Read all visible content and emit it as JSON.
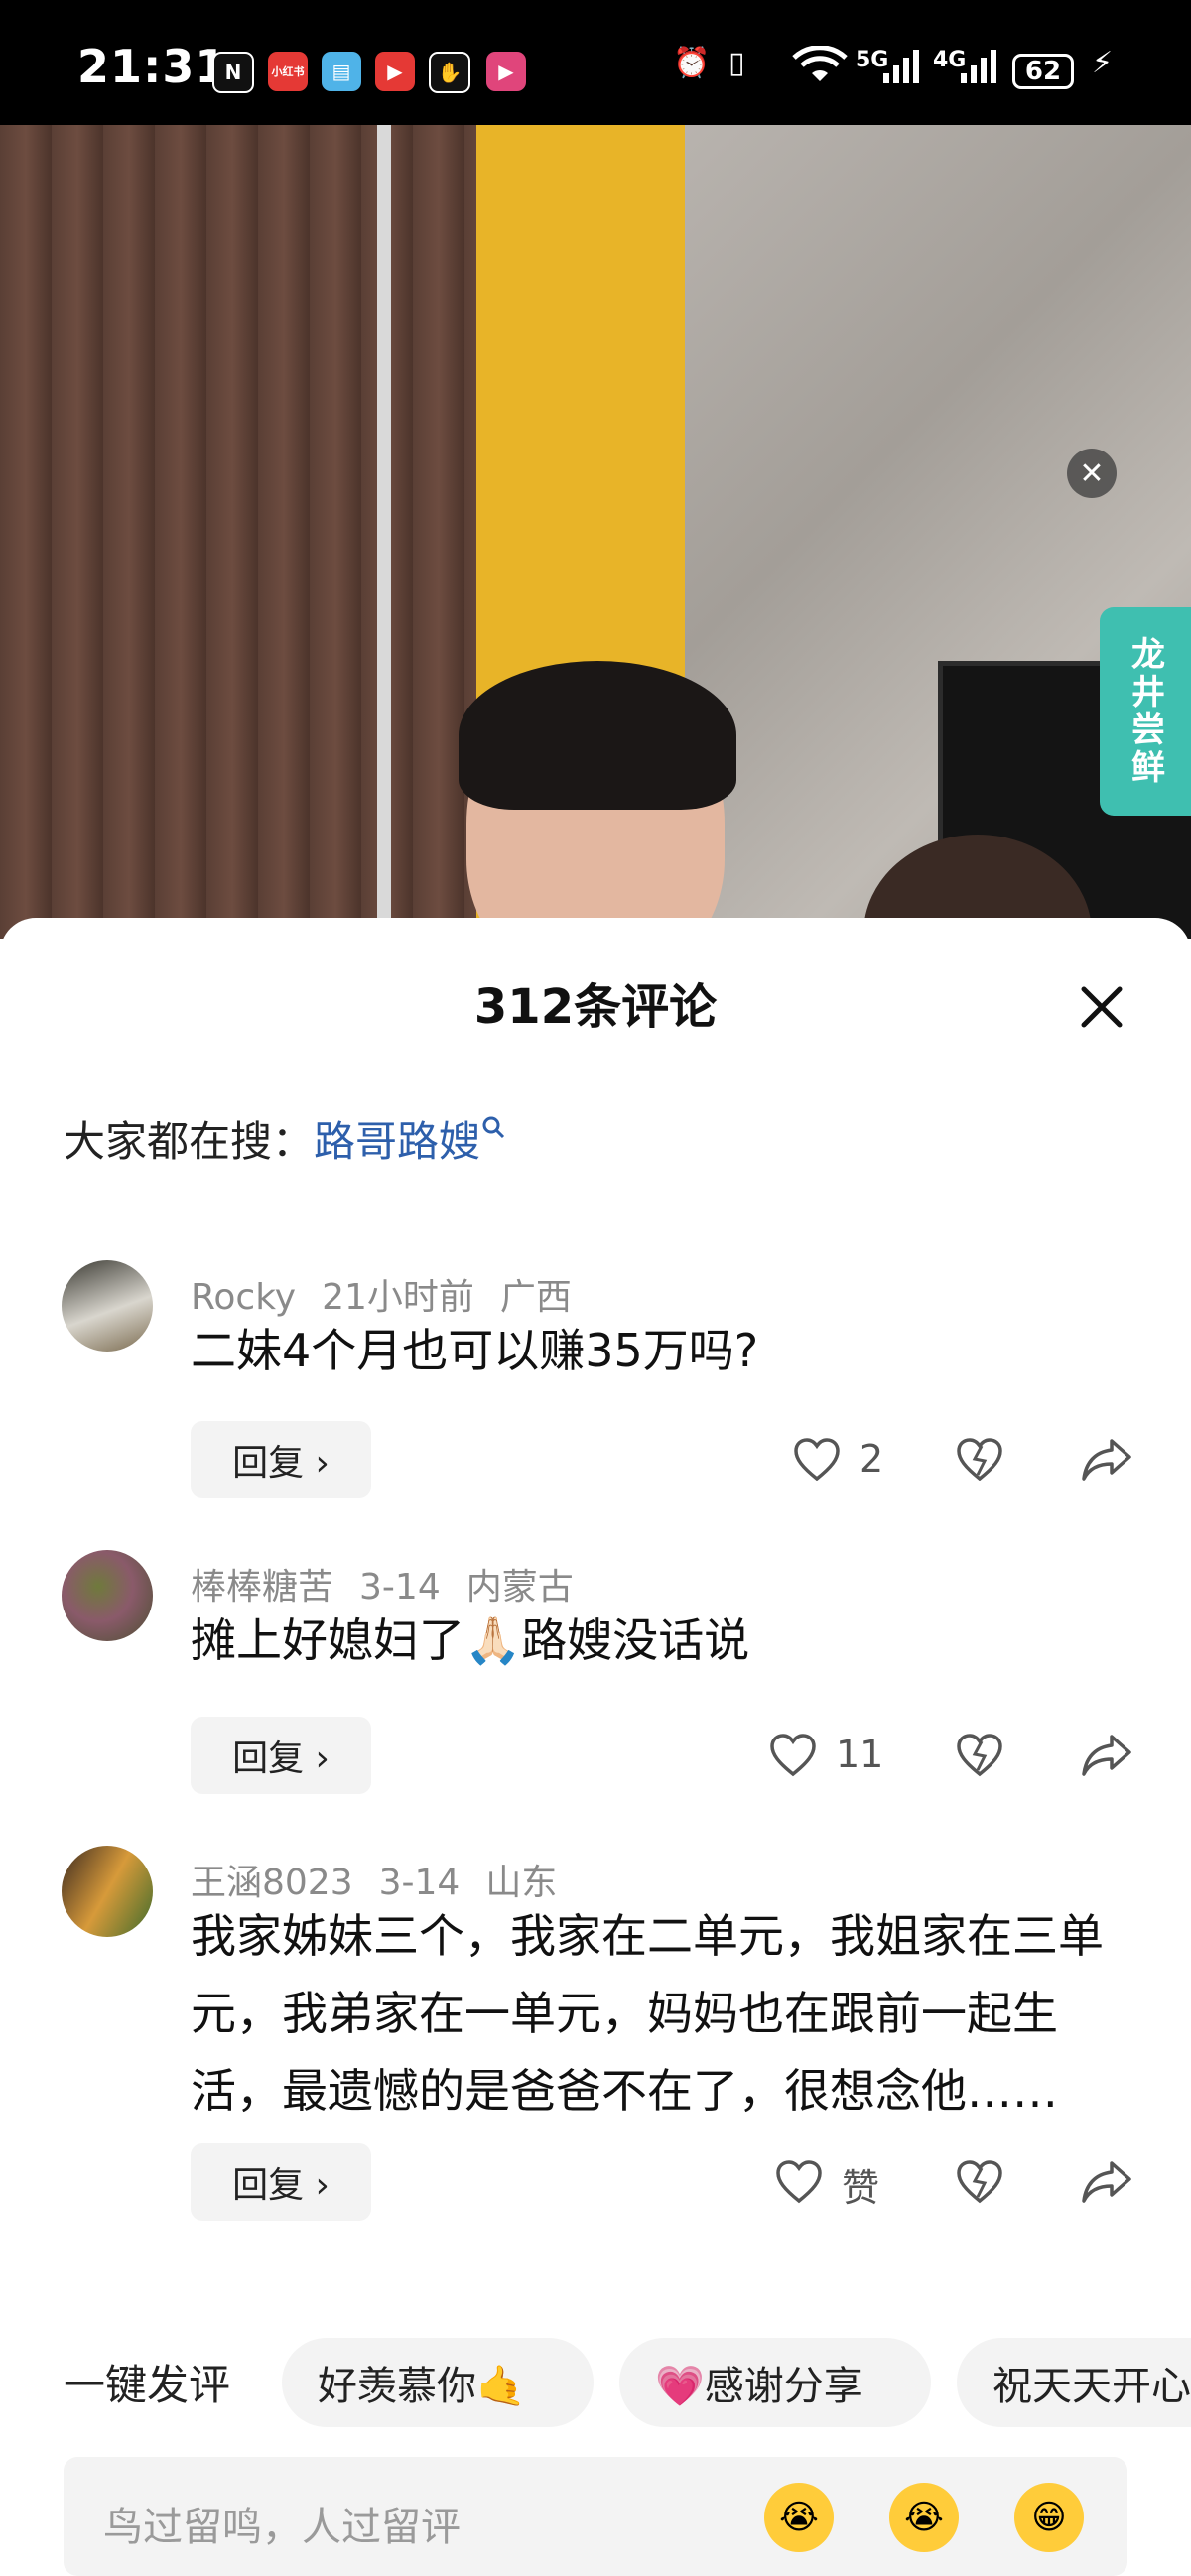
{
  "status_bar": {
    "time": "21:31",
    "network_5g": "5G",
    "network_4g": "4G",
    "battery": "62",
    "app_badge": "小红书"
  },
  "video": {
    "banner_text": "龙井尝鲜"
  },
  "sheet": {
    "title": "312条评论",
    "search_label": "大家都在搜：",
    "search_keyword": "路哥路嫂"
  },
  "comments": [
    {
      "user": "Rocky",
      "time": "21小时前",
      "location": "广西",
      "text": "二妹4个月也可以赚35万吗?",
      "reply_label": "回复 ›",
      "likes": "2"
    },
    {
      "user": "棒棒糖苦",
      "time": "3-14",
      "location": "内蒙古",
      "text": "摊上好媳妇了🙏🏻路嫂没话说",
      "reply_label": "回复 ›",
      "likes": "11"
    },
    {
      "user": "王涵8023",
      "time": "3-14",
      "location": "山东",
      "text": "我家姊妹三个，我家在二单元，我姐家在三单元，我弟家在一单元，妈妈也在跟前一起生活，最遗憾的是爸爸不在了，很想念他……",
      "reply_label": "回复 ›",
      "likes": "赞"
    }
  ],
  "quick_comment": {
    "label": "一键发评",
    "chips": [
      "好羡慕你🤙",
      "💗感谢分享",
      "祝天天开心"
    ]
  },
  "input": {
    "placeholder": "鸟过留鸣，人过留评",
    "emojis": [
      "😭",
      "😭",
      "😁"
    ]
  },
  "colors": {
    "keyword_blue": "#2d5fab",
    "banner_teal": "#3fbfb0",
    "chip_bg": "#f3f3f3"
  }
}
